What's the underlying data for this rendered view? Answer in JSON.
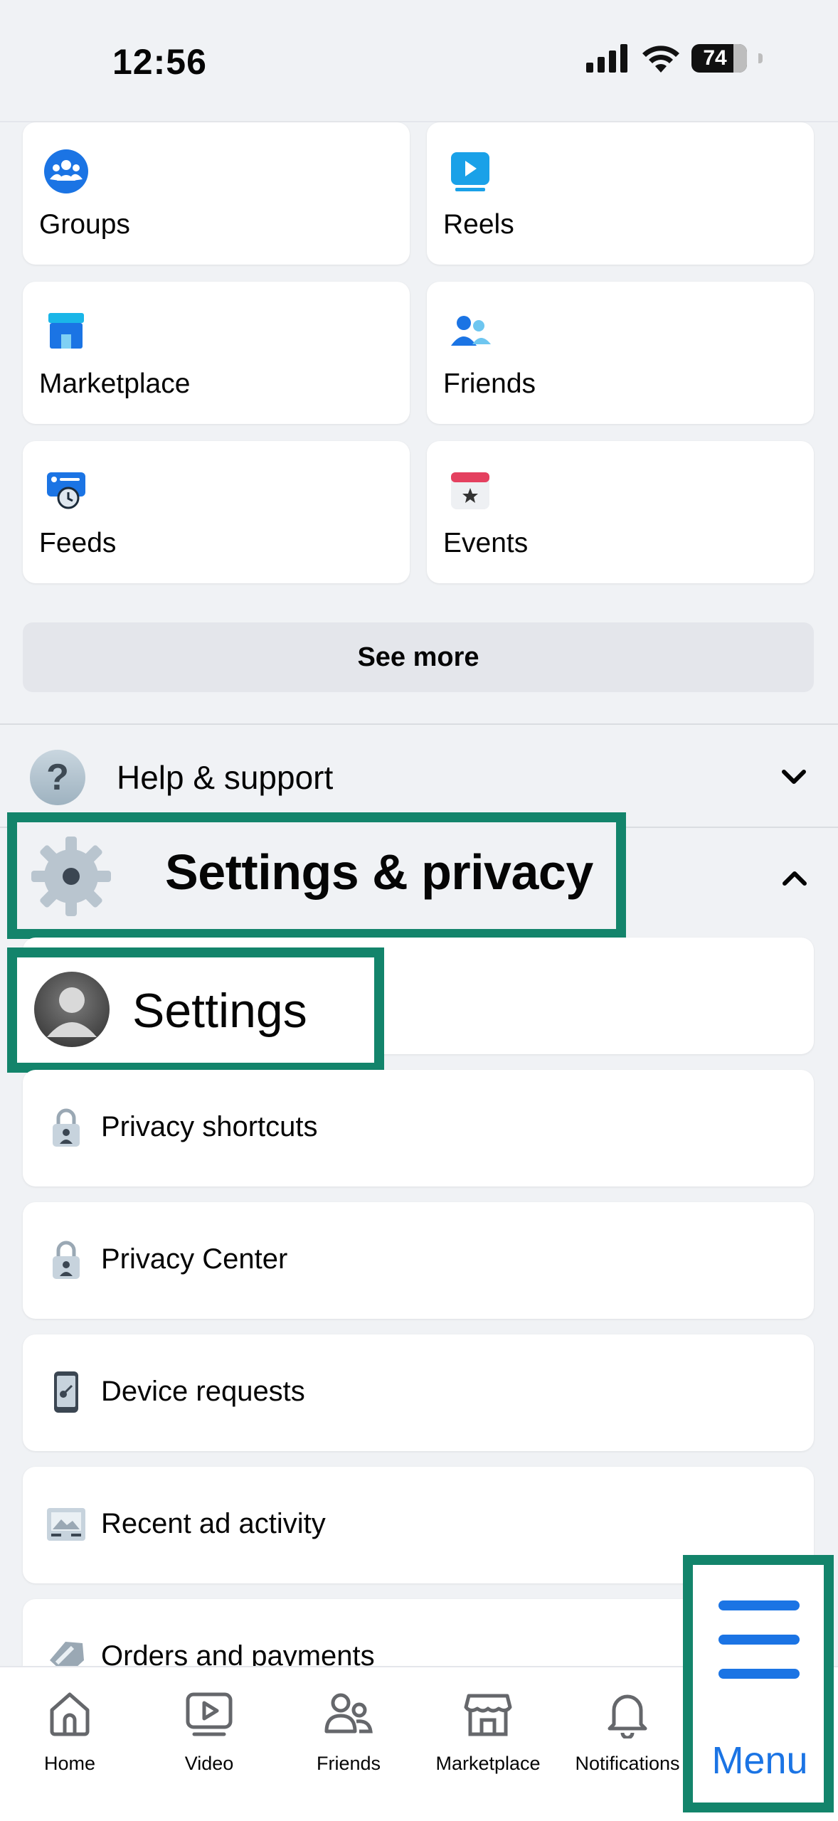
{
  "status": {
    "time": "12:56",
    "battery": "74"
  },
  "shortcuts": [
    {
      "label": "Groups",
      "icon": "groups-icon"
    },
    {
      "label": "Reels",
      "icon": "reels-icon"
    },
    {
      "label": "Marketplace",
      "icon": "marketplace-icon"
    },
    {
      "label": "Friends",
      "icon": "friends-icon"
    },
    {
      "label": "Feeds",
      "icon": "feeds-icon"
    },
    {
      "label": "Events",
      "icon": "events-icon"
    }
  ],
  "see_more": "See more",
  "help": {
    "label": "Help & support"
  },
  "settings_privacy": {
    "label": "Settings & privacy",
    "items": [
      {
        "label": "Settings",
        "icon": "avatar"
      },
      {
        "label": "Privacy shortcuts",
        "icon": "lock-icon"
      },
      {
        "label": "Privacy Center",
        "icon": "lock-icon"
      },
      {
        "label": "Device requests",
        "icon": "phone-key-icon"
      },
      {
        "label": "Recent ad activity",
        "icon": "ad-activity-icon"
      },
      {
        "label": "Orders and payments",
        "icon": "tag-icon"
      }
    ]
  },
  "bottom_nav": {
    "items": [
      {
        "label": "Home",
        "icon": "home-icon"
      },
      {
        "label": "Video",
        "icon": "video-icon"
      },
      {
        "label": "Friends",
        "icon": "friends-outline-icon"
      },
      {
        "label": "Marketplace",
        "icon": "marketplace-outline-icon"
      },
      {
        "label": "Notifications",
        "icon": "bell-icon"
      },
      {
        "label": "Menu",
        "icon": "hamburger-icon"
      }
    ]
  },
  "colors": {
    "accent": "#1b74e4",
    "highlight": "#13846b",
    "background": "#f0f2f5"
  }
}
